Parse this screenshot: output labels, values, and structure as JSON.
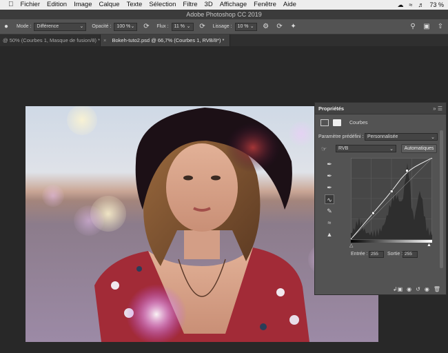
{
  "menubar": {
    "items": [
      "Fichier",
      "Edition",
      "Image",
      "Calque",
      "Texte",
      "Sélection",
      "Filtre",
      "3D",
      "Affichage",
      "Fenêtre",
      "Aide"
    ],
    "battery": "73 %"
  },
  "window": {
    "title": "Adobe Photoshop CC 2019"
  },
  "options": {
    "mode_label": "Mode :",
    "mode_value": "Différence",
    "opacity_label": "Opacité :",
    "opacity_value": "100 %",
    "flow_label": "Flux :",
    "flow_value": "11 %",
    "smoothing_label": "Lissage :",
    "smoothing_value": "10 %"
  },
  "tabs": [
    {
      "label": "@ 50% (Courbes 1, Masque de fusion/8) *",
      "active": false
    },
    {
      "label": "Bokeh-tuto2.psd @ 66,7% (Courbes 1, RVB/8*) *",
      "active": true
    }
  ],
  "properties": {
    "title": "Propriétés",
    "layer_type": "Courbes",
    "preset_label": "Paramètre prédéfini :",
    "preset_value": "Personnalisée",
    "channel_value": "RVB",
    "auto_button": "Automatiques",
    "input_label": "Entrée :",
    "input_value": "255",
    "output_label": "Sortie :",
    "output_value": "255"
  },
  "curve": {
    "points": [
      [
        0,
        0
      ],
      [
        70,
        82
      ],
      [
        128,
        150
      ],
      [
        176,
        215
      ],
      [
        255,
        255
      ]
    ]
  },
  "colors": {
    "panel_bg": "#535353",
    "workspace_bg": "#282828",
    "accent_tab": "#404040"
  }
}
